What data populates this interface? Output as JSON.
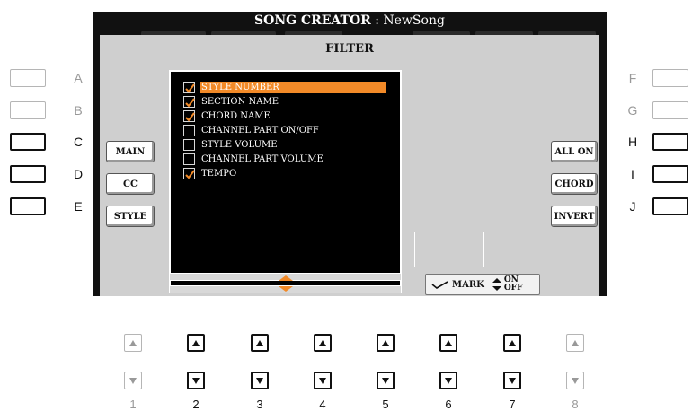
{
  "header": {
    "title": "SONG CREATOR",
    "separator": " : ",
    "song_name": "NewSong"
  },
  "panel": {
    "title": "FILTER"
  },
  "left_buttons": [
    {
      "label": "MAIN"
    },
    {
      "label": "CC"
    },
    {
      "label": "STYLE"
    }
  ],
  "right_buttons": [
    {
      "label": "ALL ON"
    },
    {
      "label": "CHORD"
    },
    {
      "label": "INVERT"
    }
  ],
  "filter_items": [
    {
      "label": "STYLE NUMBER",
      "checked": true,
      "selected": true
    },
    {
      "label": "SECTION NAME",
      "checked": true,
      "selected": false
    },
    {
      "label": "CHORD NAME",
      "checked": true,
      "selected": false
    },
    {
      "label": "CHANNEL PART ON/OFF",
      "checked": false,
      "selected": false
    },
    {
      "label": "STYLE VOLUME",
      "checked": false,
      "selected": false
    },
    {
      "label": "CHANNEL PART VOLUME",
      "checked": false,
      "selected": false
    },
    {
      "label": "TEMPO",
      "checked": true,
      "selected": false
    }
  ],
  "legend": {
    "mark_label": "MARK",
    "on_label": "ON",
    "off_label": "OFF"
  },
  "hardware": {
    "left_letters": [
      "A",
      "B",
      "C",
      "D",
      "E"
    ],
    "right_letters": [
      "F",
      "G",
      "H",
      "I",
      "J"
    ],
    "bottom_numbers": [
      "1",
      "2",
      "3",
      "4",
      "5",
      "6",
      "7",
      "8"
    ]
  },
  "colors": {
    "highlight": "#f28a28",
    "lcd_background": "#111111",
    "panel_background": "#cfcfcf"
  }
}
